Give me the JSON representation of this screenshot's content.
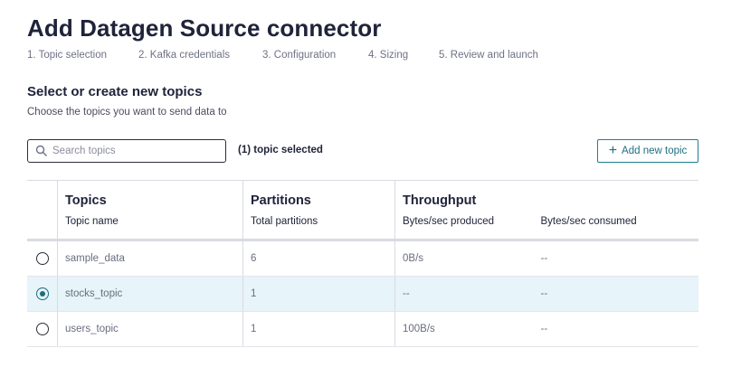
{
  "page": {
    "title": "Add Datagen Source connector",
    "steps": [
      "1. Topic selection",
      "2. Kafka credentials",
      "3. Configuration",
      "4. Sizing",
      "5. Review and launch"
    ]
  },
  "section": {
    "title": "Select or create new topics",
    "subtitle": "Choose the topics you want to send data to"
  },
  "search": {
    "placeholder": "Search topics",
    "value": ""
  },
  "selection": {
    "label": "(1) topic selected"
  },
  "add_button": {
    "label": "Add new topic",
    "icon": "plus-icon"
  },
  "table": {
    "groups": {
      "topics": "Topics",
      "partitions": "Partitions",
      "throughput": "Throughput"
    },
    "columns": {
      "topic_name": "Topic name",
      "total_partitions": "Total partitions",
      "bytes_produced": "Bytes/sec produced",
      "bytes_consumed": "Bytes/sec consumed"
    },
    "rows": [
      {
        "name": "sample_data",
        "partitions": "6",
        "produced": "0B/s",
        "consumed": "--",
        "selected": false
      },
      {
        "name": "stocks_topic",
        "partitions": "1",
        "produced": "--",
        "consumed": "--",
        "selected": true
      },
      {
        "name": "users_topic",
        "partitions": "1",
        "produced": "100B/s",
        "consumed": "--",
        "selected": false
      }
    ]
  },
  "colors": {
    "accent": "#1b6d80",
    "selected_row_bg": "#e7f4f9",
    "title": "#20243a"
  }
}
